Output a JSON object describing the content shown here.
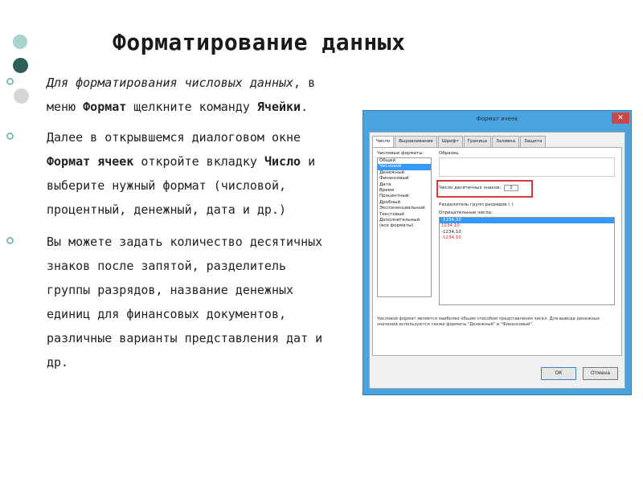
{
  "slide": {
    "title": "Форматирование данных",
    "bullets": [
      {
        "p1": "Для форматирования числовых данных",
        "p2": ", в меню ",
        "p3": "Формат",
        "p4": " щелкните команду ",
        "p5": "Ячейки",
        "p6": "."
      },
      {
        "p1": "Далее в открывшемся диалоговом окне ",
        "p2": "Формат ячеек",
        "p3": " откройте вкладку ",
        "p4": "Число",
        "p5": " и выберите нужный формат (числовой, процентный, денежный, дата и др.)"
      },
      {
        "text": "Вы можете задать количество десятичных знаков после запятой, разделитель группы разрядов, название денежных единиц для финансовых документов, различные варианты представления дат и др."
      }
    ]
  },
  "dialog": {
    "title": "Формат ячеек",
    "close": "✕",
    "tabs": [
      "Число",
      "Выравнивание",
      "Шрифт",
      "Граница",
      "Заливка",
      "Защита"
    ],
    "categories_label": "Числовые форматы:",
    "categories": [
      "Общий",
      "Числовой",
      "Денежный",
      "Финансовый",
      "Дата",
      "Время",
      "Процентный",
      "Дробный",
      "Экспоненциальный",
      "Текстовый",
      "Дополнительный",
      "(все форматы)"
    ],
    "sample_label": "Образец",
    "decimals_label": "Число десятичных знаков:",
    "decimals_value": "2",
    "separator_label": "Разделитель групп разрядов ( )",
    "negatives_label": "Отрицательные числа:",
    "negatives": [
      "-1234,10",
      "1234,10",
      "-1234,10",
      "-1234,10"
    ],
    "note": "Числовой формат является наиболее общим способом представления чисел. Для вывода денежных значений используются также форматы \"Денежный\" и \"Финансовый\".",
    "ok": "ОК",
    "cancel": "Отмена"
  },
  "colors": {
    "deco1": "#a9d3cf",
    "deco2": "#2e5e5a",
    "deco3": "#d6d6d6",
    "dialog_frame": "#4aa3df",
    "highlight": "#d63b3b"
  }
}
